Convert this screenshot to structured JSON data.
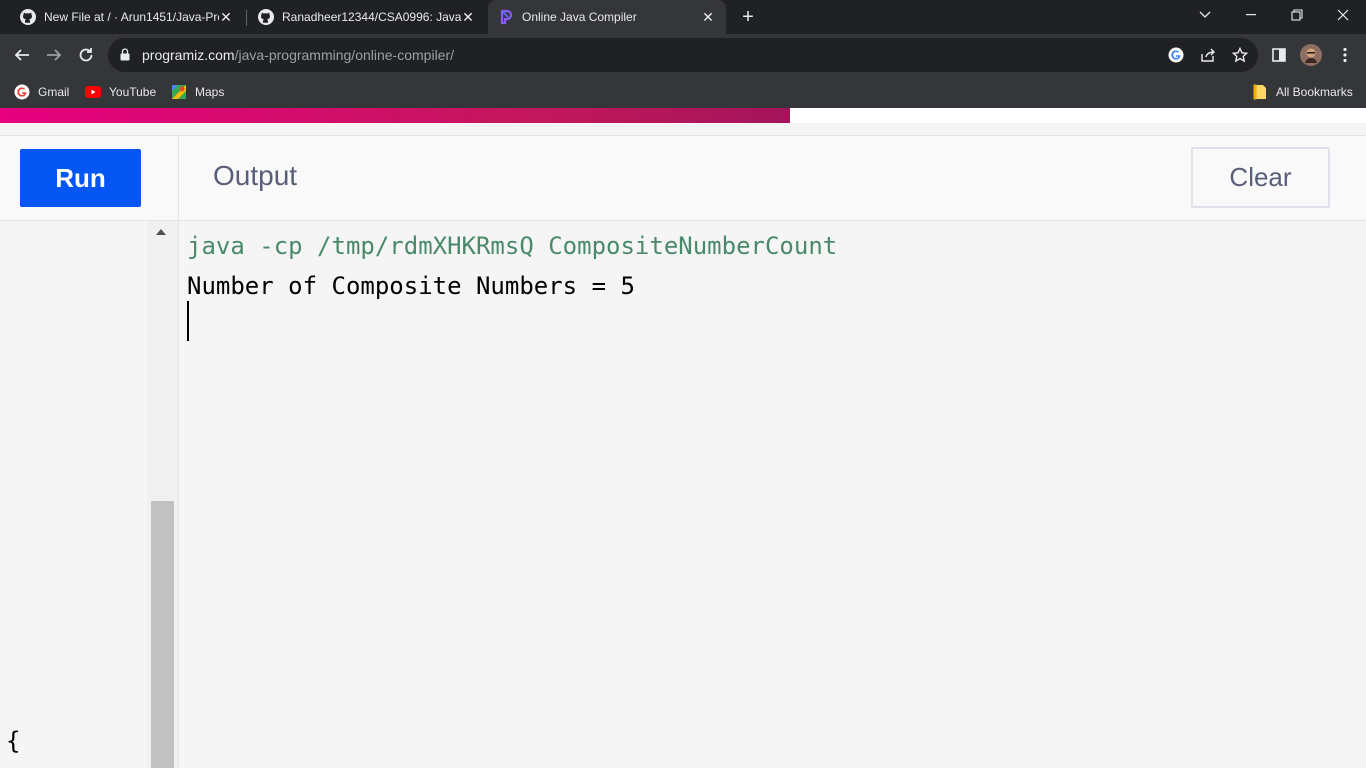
{
  "browser": {
    "tabs": [
      {
        "title": "New File at / · Arun1451/Java-Pro",
        "icon": "github-icon",
        "active": false
      },
      {
        "title": "Ranadheer12344/CSA0996: Java",
        "icon": "github-icon",
        "active": false
      },
      {
        "title": "Online Java Compiler",
        "icon": "programiz-icon",
        "active": true
      }
    ],
    "url_domain": "programiz.com",
    "url_path": "/java-programming/online-compiler/",
    "bookmarks": [
      {
        "label": "Gmail",
        "icon": "google-icon"
      },
      {
        "label": "YouTube",
        "icon": "youtube-icon"
      },
      {
        "label": "Maps",
        "icon": "maps-icon"
      }
    ],
    "all_bookmarks_label": "All Bookmarks"
  },
  "page": {
    "progress": 0.578,
    "run_label": "Run",
    "output_title": "Output",
    "clear_label": "Clear",
    "editor_visible_char": "{",
    "console": {
      "command": "java -cp /tmp/rdmXHKRmsQ CompositeNumberCount",
      "result": "Number of Composite Numbers = 5"
    }
  },
  "colors": {
    "run_button": "#0556f3",
    "progress_bar": "#e6007e",
    "command_text": "#4a8a6a"
  }
}
